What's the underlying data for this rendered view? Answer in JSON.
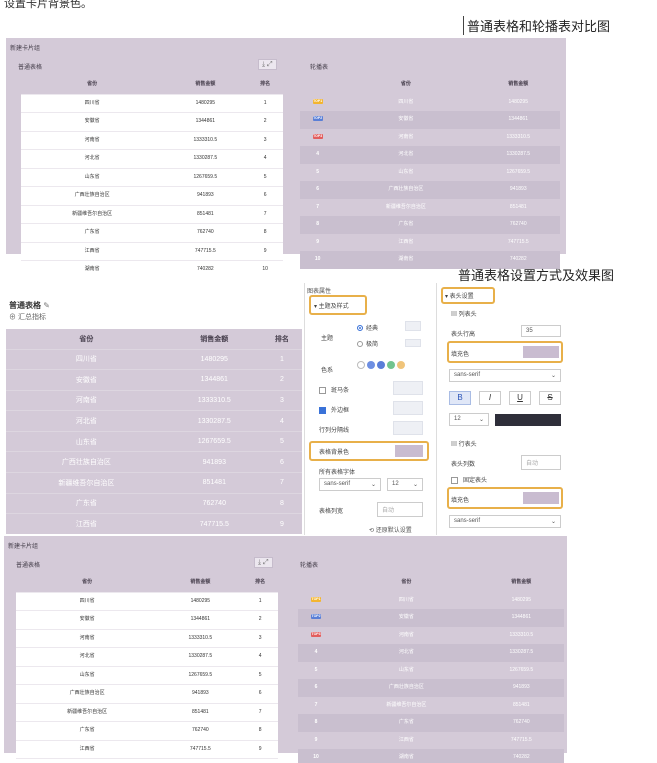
{
  "intro_text": "设置卡片背景色。",
  "caption_compare": "普通表格和轮播表对比图",
  "caption_settings": "普通表格设置方式及效果图",
  "colors": {
    "card_bg": "#d4cad8",
    "accent_orange": "#e8b04a",
    "highlight_fill": "#c9bcd0",
    "primary_blue": "#3a72d8"
  },
  "card1": {
    "tab_group": "新建卡片组",
    "plain_title": "普通表格",
    "carousel_title": "轮播表",
    "tool_icons": "⤓ ⤢",
    "columns": [
      "省份",
      "销售金额",
      "排名"
    ],
    "rows": [
      [
        "四川省",
        "1480295",
        "1"
      ],
      [
        "安徽省",
        "1344861",
        "2"
      ],
      [
        "河南省",
        "1333310.5",
        "3"
      ],
      [
        "河北省",
        "1330287.5",
        "4"
      ],
      [
        "山东省",
        "1267659.5",
        "5"
      ],
      [
        "广西壮族自治区",
        "941893",
        "6"
      ],
      [
        "新疆维吾尔自治区",
        "851481",
        "7"
      ],
      [
        "广东省",
        "762740",
        "8"
      ],
      [
        "江西省",
        "747715.5",
        "9"
      ],
      [
        "湖南省",
        "740282",
        "10"
      ]
    ],
    "badges": [
      "TOP1",
      "TOP2",
      "TOP3"
    ]
  },
  "settings": {
    "table_title": "普通表格",
    "edit_icon": "✎",
    "summary_label": "⊕ 汇总指标",
    "columns": [
      "省份",
      "销售金额",
      "排名"
    ],
    "rows": [
      [
        "四川省",
        "1480295",
        "1"
      ],
      [
        "安徽省",
        "1344861",
        "2"
      ],
      [
        "河南省",
        "1333310.5",
        "3"
      ],
      [
        "河北省",
        "1330287.5",
        "4"
      ],
      [
        "山东省",
        "1267659.5",
        "5"
      ],
      [
        "广西壮族自治区",
        "941893",
        "6"
      ],
      [
        "新疆维吾尔自治区",
        "851481",
        "7"
      ],
      [
        "广东省",
        "762740",
        "8"
      ],
      [
        "江西省",
        "747715.5",
        "9"
      ]
    ],
    "mid": {
      "panel_title": "图表属性",
      "section": "▾ 主题及样式",
      "theme_label": "主题",
      "theme_classic": "经典",
      "theme_dark": "极简",
      "color_label": "色系",
      "zebra_label": "斑马条",
      "outer_border_label": "外边框",
      "row_divider_label": "行列分隔线",
      "table_bg_label": "表格背景色",
      "font_label": "所有表格字体",
      "font_value": "sans-serif",
      "font_size": "12",
      "col_width_label": "表格列宽",
      "col_width_value": "自动",
      "reset_label": "⟲ 还原默认设置"
    },
    "right": {
      "section": "▾ 表头设置",
      "col_header": "▤ 列表头",
      "row_height_label": "表头行高",
      "row_height_value": "35",
      "fill_label": "填充色",
      "font_value": "sans-serif",
      "bold": "B",
      "italic": "I",
      "underline": "U",
      "strike": "S",
      "font_size": "12",
      "row_header": "▤ 行表头",
      "header_cols_label": "表头列数",
      "header_cols_value": "自动",
      "fixed_header_label": "固定表头",
      "fill_label2": "填充色",
      "font_value2": "sans-serif"
    }
  }
}
